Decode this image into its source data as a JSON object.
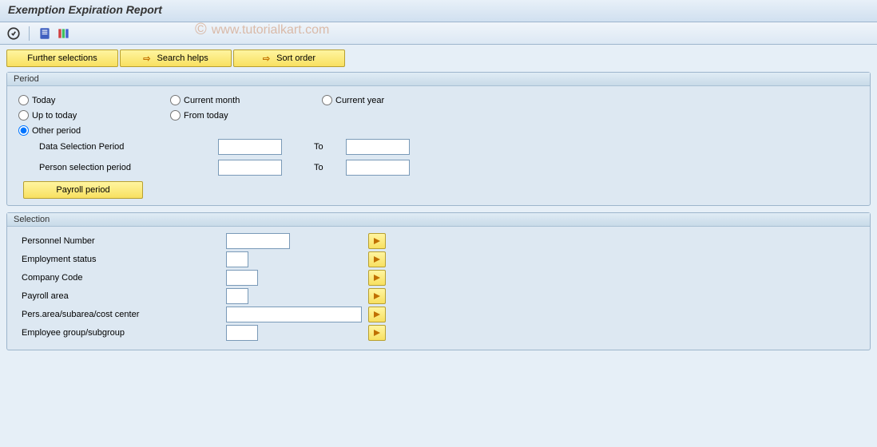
{
  "title": "Exemption Expiration Report",
  "watermark": "www.tutorialkart.com",
  "actions": {
    "further_selections": "Further selections",
    "search_helps": "Search helps",
    "sort_order": "Sort order"
  },
  "period": {
    "group_label": "Period",
    "radios": {
      "today": "Today",
      "current_month": "Current month",
      "current_year": "Current year",
      "up_to_today": "Up to today",
      "from_today": "From today",
      "other_period": "Other period"
    },
    "fields": {
      "data_selection": "Data Selection Period",
      "person_selection": "Person selection period",
      "to": "To"
    },
    "payroll_period_btn": "Payroll period"
  },
  "selection": {
    "group_label": "Selection",
    "fields": {
      "personnel_number": "Personnel Number",
      "employment_status": "Employment status",
      "company_code": "Company Code",
      "payroll_area": "Payroll area",
      "pers_area": "Pers.area/subarea/cost center",
      "employee_group": "Employee group/subgroup"
    }
  }
}
